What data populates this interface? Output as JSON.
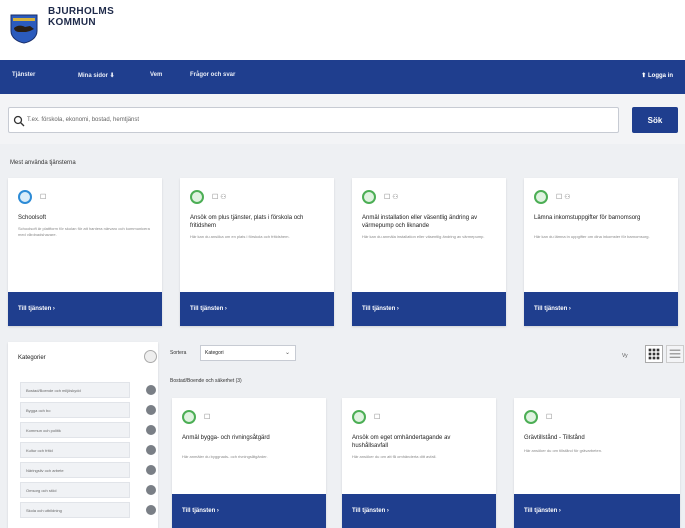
{
  "brand": {
    "line1": "BJURHOLMS",
    "line2": "KOMMUN"
  },
  "nav": {
    "items": [
      "Tjänster",
      "Mina sidor ⬇",
      "Vem",
      "Frågor och svar"
    ],
    "login": "⬆ Logga in"
  },
  "search": {
    "placeholder": "T.ex. förskola, ekonomi, bostad, hemtjänst",
    "button": "Sök"
  },
  "popular": {
    "title": "Mest använda tjänsterna",
    "cards": [
      {
        "title": "Schoolsoft",
        "desc": "Schoolsoft är plattform för skolan för att hantera närvaro och kommunicera med vårdnadshavare.",
        "link": "Till tjänsten ›",
        "icons": "☐"
      },
      {
        "title": "Ansök om plus tjänster, plats i förskola och fritidshem",
        "desc": "Här kan du ansöka om en plats i förskola och fritidshem.",
        "link": "Till tjänsten ›",
        "icons": "☐ ⚇"
      },
      {
        "title": "Anmäl installation eller väsentlig ändring av värmepump och liknande",
        "desc": "Här kan du anmäla installation eller väsentlig ändring av värmepump.",
        "link": "Till tjänsten ›",
        "icons": "☐ ⚇"
      },
      {
        "title": "Lämna inkomstuppgifter för barnomsorg",
        "desc": "Här kan du lämna in uppgifter om dina inkomster för barnomsorg.",
        "link": "Till tjänsten ›",
        "icons": "☐ ⚇"
      }
    ]
  },
  "filters": {
    "title": "Kategorier",
    "items": [
      "Bostad/Boende och miljöskydd",
      "Bygga och bo",
      "Kommun och politik",
      "Kultur och fritid",
      "Näringsliv och arbete",
      "Omsorg och stöd",
      "Skola och utbildning",
      "Trafik och infrastruktur"
    ]
  },
  "sort": {
    "label": "Sortera",
    "value": "Kategori"
  },
  "active_filter": "Bostad/Boende och säkerhet (3)",
  "view": {
    "label": "Vy"
  },
  "results": {
    "cards": [
      {
        "title": "Anmäl bygga- och rivningsåtgärd",
        "desc": "Här anmäler du byggnads- och rivningsåtgärder.",
        "link": "Till tjänsten ›",
        "icons": "☐"
      },
      {
        "title": "Ansök om eget omhändertagande av hushållsavfall",
        "desc": "Här ansöker du om att få omhänderta ditt avfall.",
        "link": "Till tjänsten ›",
        "icons": "☐"
      },
      {
        "title": "Grävtillstånd - Tillstånd",
        "desc": "Här ansöker du om tillstånd för grävarbeten.",
        "link": "Till tjänsten ›",
        "icons": "☐"
      }
    ]
  }
}
